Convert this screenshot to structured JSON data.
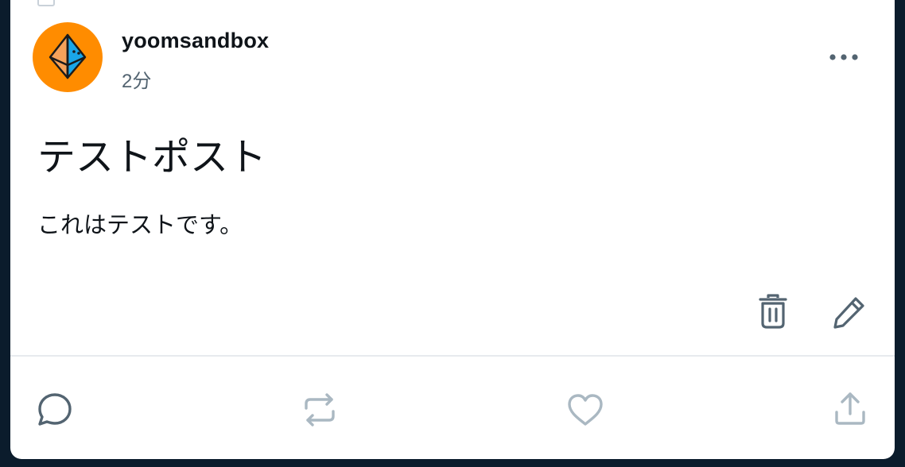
{
  "post": {
    "username": "yoomsandbox",
    "time": "2分",
    "title": "テストポスト",
    "body": "これはテストです。"
  },
  "icons": {
    "avatar": "origami-octahedron-avatar",
    "more": "more-dots-icon",
    "delete": "trash-icon",
    "edit": "pencil-icon",
    "reply": "comment-icon",
    "repost": "repost-icon",
    "like": "heart-icon",
    "share": "share-upload-icon"
  },
  "colors": {
    "avatar_bg": "#ff8c00",
    "text_primary": "#0f1419",
    "text_secondary": "#536471",
    "action_icon_active": "#536471",
    "action_icon_muted": "#aab8c2"
  }
}
